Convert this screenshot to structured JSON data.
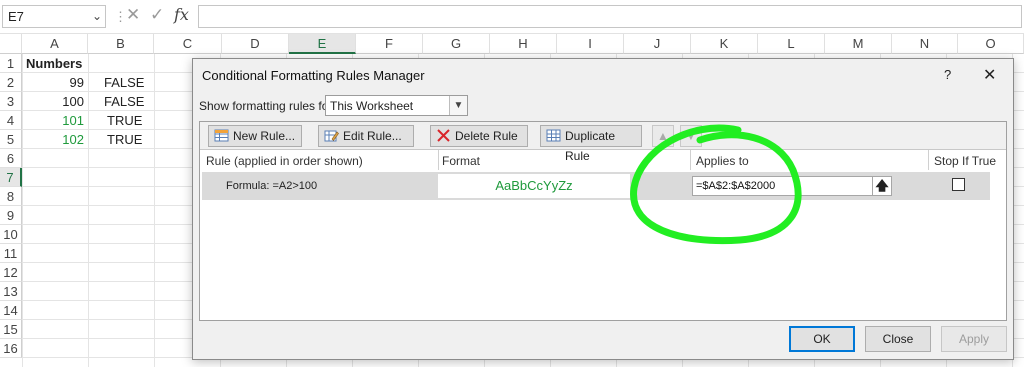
{
  "formula_bar": {
    "name_box": "E7",
    "cancel_icon": "close-icon",
    "enter_icon": "check-icon",
    "fx_label": "fx",
    "formula_value": ""
  },
  "columns": [
    "A",
    "B",
    "C",
    "D",
    "E",
    "F",
    "G",
    "H",
    "I",
    "J",
    "K",
    "L",
    "M",
    "N",
    "O"
  ],
  "selected_column": "E",
  "rows": [
    "1",
    "2",
    "3",
    "4",
    "5",
    "6",
    "7",
    "8",
    "9",
    "10",
    "11",
    "12",
    "13",
    "14",
    "15",
    "16"
  ],
  "selected_row": "7",
  "cells": {
    "a1": "Numbers",
    "a2": "99",
    "b2": "FALSE",
    "a3": "100",
    "b3": "FALSE",
    "a4": "101",
    "b4": "TRUE",
    "a5": "102",
    "b5": "TRUE"
  },
  "dialog": {
    "title": "Conditional Formatting Rules Manager",
    "help": "?",
    "show_label": "Show formatting rules for:",
    "show_value": "This Worksheet",
    "toolbar": {
      "new_rule": "New Rule...",
      "edit_rule": "Edit Rule...",
      "delete_rule": "Delete Rule",
      "duplicate_rule": "Duplicate Rule"
    },
    "headers": {
      "rule": "Rule (applied in order shown)",
      "format": "Format",
      "applies_to": "Applies to",
      "stop_if_true": "Stop If True"
    },
    "rule": {
      "formula": "Formula: =A2>100",
      "format_sample": "AaBbCcYyZz",
      "applies_to": "=$A$2:$A$2000",
      "stop_if_true": false
    },
    "buttons": {
      "ok": "OK",
      "close": "Close",
      "apply": "Apply"
    }
  },
  "colors": {
    "accent": "#217346",
    "true_text": "#1f9a3c",
    "highlight_circle": "#22ee22",
    "ok_border": "#0078d7"
  }
}
